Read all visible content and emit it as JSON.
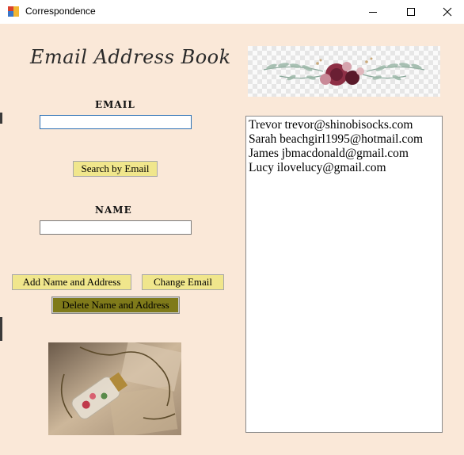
{
  "window": {
    "title": "Correspondence",
    "icon": "app-grid-icon",
    "controls": [
      "minimize-icon",
      "maximize-icon",
      "close-icon"
    ]
  },
  "form": {
    "heading": "Email Address Book",
    "email_label": "EMAIL",
    "email_value": "",
    "search_button": "Search by Email",
    "name_label": "NAME",
    "name_value": "",
    "add_button": "Add Name and Address",
    "change_button": "Change Email",
    "delete_button": "Delete Name and Address"
  },
  "listbox": {
    "items": [
      "Trevor trevor@shinobisocks.com",
      "Sarah beachgirl1995@hotmail.com",
      "James jbmacdonald@gmail.com",
      "Lucy ilovelucy@gmail.com"
    ]
  },
  "colors": {
    "form_background": "#fae8d8",
    "button_background": "#f0e68c",
    "delete_button_background": "#7f7a1a",
    "focus_border": "#2a6fb3"
  },
  "images": {
    "banner": "floral-banner-image",
    "photo": "bottle-necklace-photo"
  }
}
